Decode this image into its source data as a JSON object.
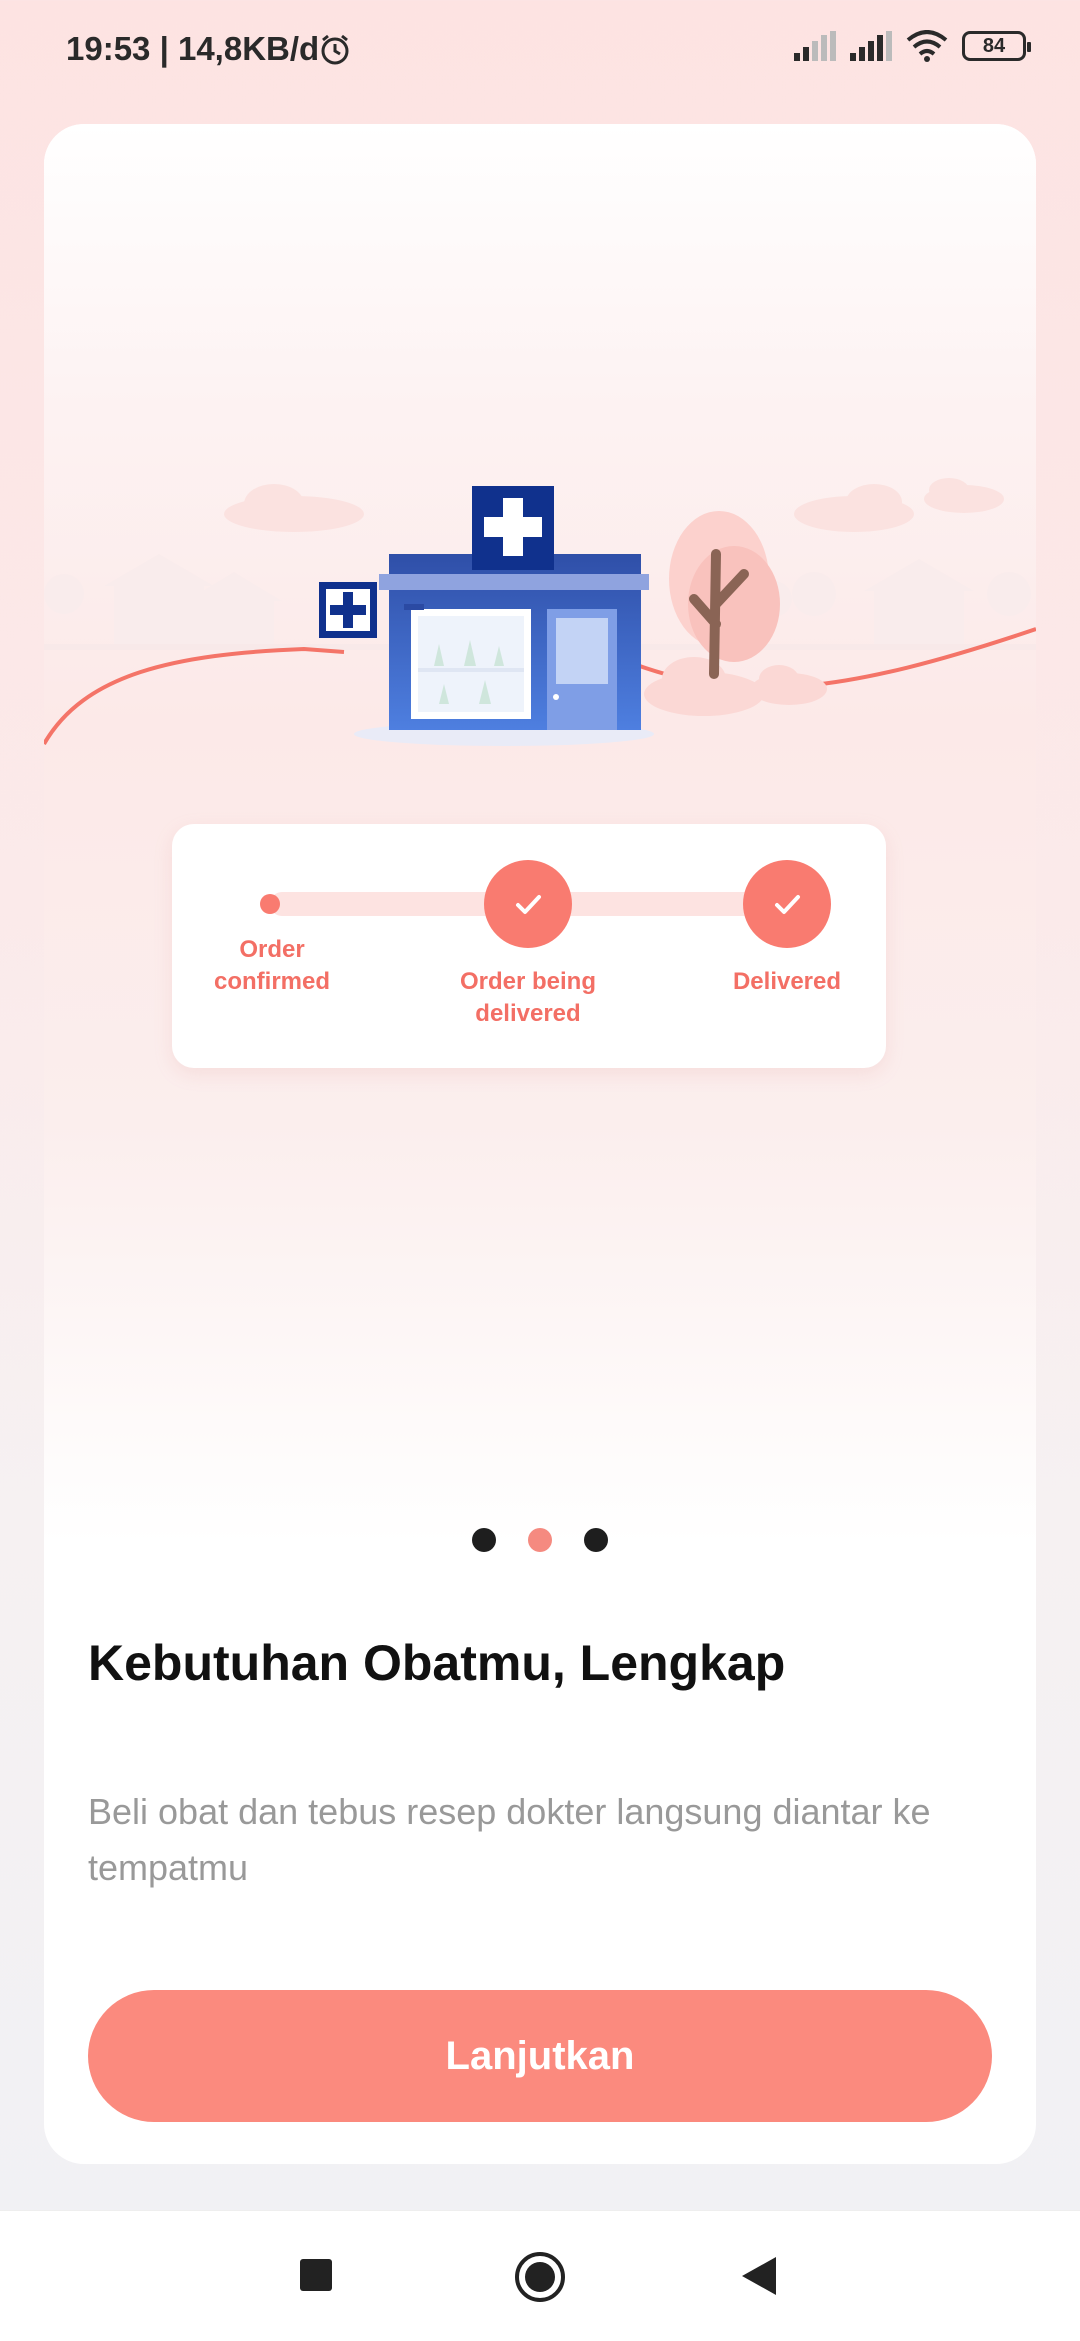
{
  "status_bar": {
    "time": "19:53 | 14,8KB/d",
    "battery": "84",
    "icons": [
      "alarm-icon",
      "signal-icon",
      "signal-icon",
      "wifi-icon",
      "battery-icon"
    ]
  },
  "tracker": {
    "steps": [
      "Order confirmed",
      "Order being delivered",
      "Delivered"
    ]
  },
  "onboarding": {
    "title": "Kebutuhan Obatmu, Lengkap",
    "description": "Beli obat dan tebus resep dokter langsung diantar ke tempatmu",
    "button_label": "Lanjutkan",
    "page_count": 3,
    "active_page": 2
  },
  "colors": {
    "accent": "#fb8a7e",
    "tracker_accent": "#f97b70",
    "pharmacy_blue": "#2e5cbf"
  },
  "navbar": {
    "icons": [
      "recents-square-icon",
      "home-circle-icon",
      "back-triangle-icon"
    ]
  }
}
